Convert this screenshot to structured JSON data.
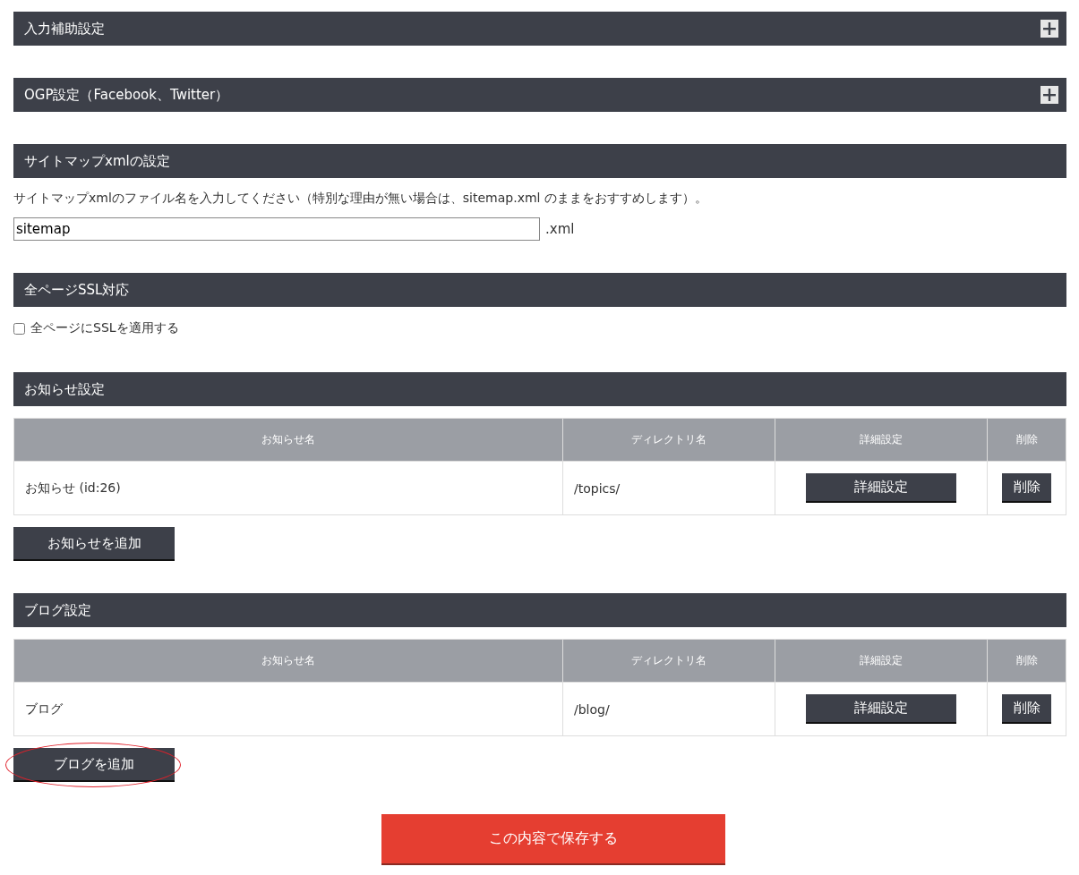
{
  "sections": [
    {
      "kind": "collapsible",
      "title": "入力補助設定",
      "expanded": false
    },
    {
      "kind": "collapsible",
      "title": "OGP設定（Facebook、Twitter）",
      "expanded": false
    },
    {
      "kind": "filename",
      "title": "サイトマップxmlの設定",
      "description": "サイトマップxmlのファイル名を入力してください（特別な理由が無い場合は、sitemap.xml のままをおすすめします）。",
      "value": "sitemap",
      "suffix": ".xml"
    },
    {
      "kind": "checkbox",
      "title": "全ページSSL対応",
      "label": "全ページにSSLを適用する",
      "checked": false
    },
    {
      "kind": "table",
      "title": "お知らせ設定",
      "columns": [
        "お知らせ名",
        "ディレクトリ名",
        "詳細設定",
        "削除"
      ],
      "rows": [
        {
          "name": "お知らせ (id:26)",
          "directory": "/topics/",
          "detail_button": "詳細設定",
          "delete_button": "削除"
        }
      ],
      "add_button": {
        "label": "お知らせを追加",
        "highlighted": false
      }
    },
    {
      "kind": "table",
      "title": "ブログ設定",
      "columns": [
        "お知らせ名",
        "ディレクトリ名",
        "詳細設定",
        "削除"
      ],
      "rows": [
        {
          "name": "ブログ",
          "directory": "/blog/",
          "detail_button": "詳細設定",
          "delete_button": "削除"
        }
      ],
      "add_button": {
        "label": "ブログを追加",
        "highlighted": true
      }
    }
  ],
  "save_button": "この内容で保存する"
}
